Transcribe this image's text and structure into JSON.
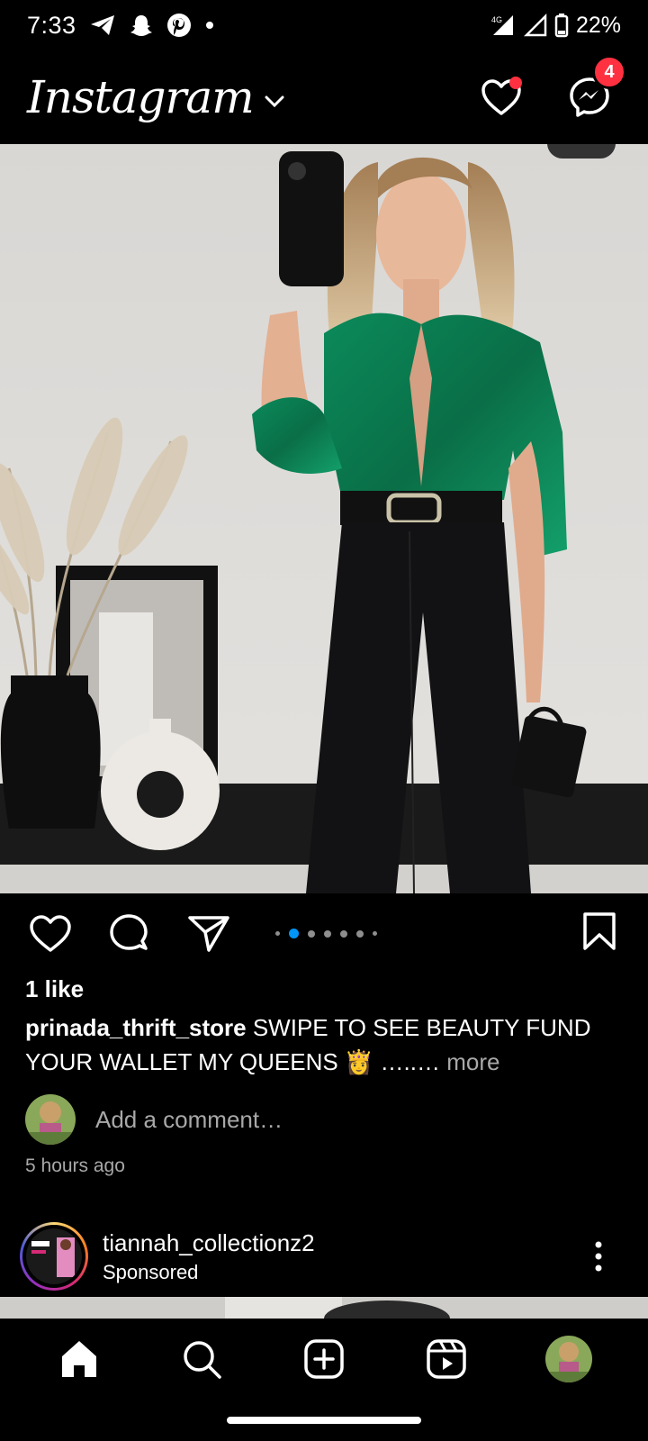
{
  "status_bar": {
    "time": "7:33",
    "network": "4G",
    "battery": "22%",
    "notification_icons": [
      "telegram-icon",
      "snapchat-icon",
      "pinterest-icon",
      "dot-icon"
    ]
  },
  "header": {
    "logo": "Instagram",
    "activity_unread": true,
    "messenger_badge": "4"
  },
  "post": {
    "image_description_icon": "photo",
    "carousel": {
      "total": 6,
      "active_index": 1
    },
    "likes": "1 like",
    "username": "prinada_thrift_store",
    "caption": "SWIPE TO SEE BEAUTY FUND YOUR WALLET MY QUEENS 👸 …..… ",
    "more_label": "more",
    "comment_placeholder": "Add a comment…",
    "time_ago": "5 hours ago"
  },
  "next_post": {
    "username": "tiannah_collectionz2",
    "sponsored_label": "Sponsored"
  },
  "colors": {
    "background": "#000000",
    "accent_blue": "#0095f6",
    "notification_red": "#ff3040",
    "secondary_text": "#a8a8a8"
  },
  "bottom_nav": [
    "home-icon",
    "search-icon",
    "create-icon",
    "reels-icon",
    "profile-avatar"
  ]
}
